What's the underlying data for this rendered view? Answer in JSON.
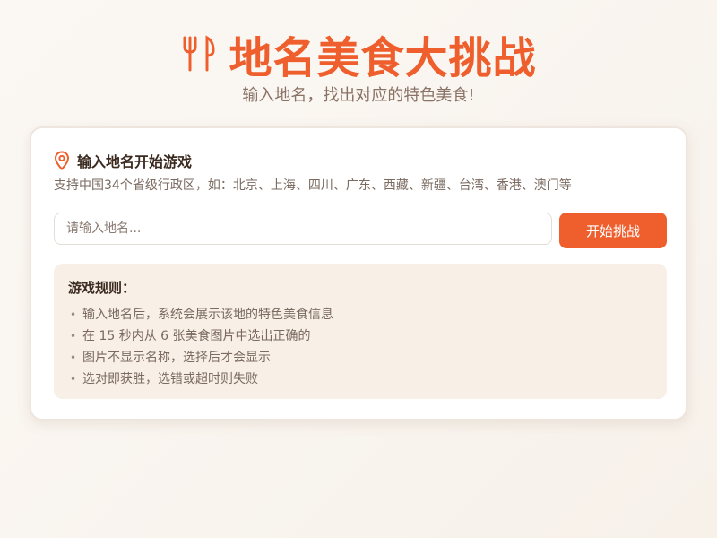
{
  "header": {
    "title": "地名美食大挑战",
    "subtitle": "输入地名，找出对应的特色美食!",
    "icon": "utensils-icon"
  },
  "card": {
    "title": "输入地名开始游戏",
    "icon": "map-pin-icon",
    "hint": "支持中国34个省级行政区，如：北京、上海、四川、广东、西藏、新疆、台湾、香港、澳门等",
    "input": {
      "placeholder": "请输入地名...",
      "value": ""
    },
    "start_button": "开始挑战"
  },
  "rules": {
    "title": "游戏规则：",
    "items": [
      "输入地名后，系统会展示该地的特色美食信息",
      "在 15 秒内从 6 张美食图片中选出正确的",
      "图片不显示名称，选择后才会显示",
      "选对即获胜，选错或超时则失败"
    ]
  },
  "colors": {
    "accent": "#ee5f2d",
    "rules_bg": "#f8efe6",
    "text_muted": "#7a6a60"
  }
}
